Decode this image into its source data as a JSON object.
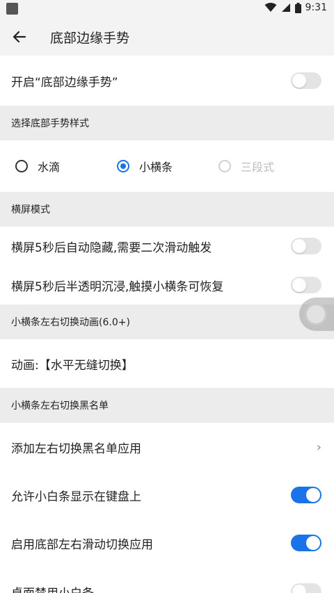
{
  "status_bar": {
    "time": "9:31",
    "left_icon": "app-square-icon",
    "icons": [
      "wifi-icon",
      "signal-icon",
      "battery-icon"
    ]
  },
  "toolbar": {
    "back_icon": "arrow-back-icon",
    "title": "底部边缘手势"
  },
  "enable_row": {
    "label": "开启“底部边缘手势”",
    "enabled": false
  },
  "style_section": {
    "title": "选择底部手势样式"
  },
  "style_options": [
    {
      "label": "水滴",
      "checked": false,
      "disabled": false
    },
    {
      "label": "小横条",
      "checked": true,
      "disabled": false
    },
    {
      "label": "三段式",
      "checked": false,
      "disabled": true
    }
  ],
  "landscape_section": {
    "title": "横屏模式"
  },
  "landscape_rows": [
    {
      "label": "横屏5秒后自动隐藏,需要二次滑动触发",
      "enabled": false
    },
    {
      "label": "横屏5秒后半透明沉浸,触摸小横条可恢复",
      "enabled": false
    }
  ],
  "anim_section": {
    "title": "小横条左右切换动画(6.0+)"
  },
  "anim_row": {
    "label": "动画:【水平无缝切换】"
  },
  "blacklist_section": {
    "title": "小横条左右切换黑名单"
  },
  "blacklist_row": {
    "label": "添加左右切换黑名单应用",
    "chevron": "›"
  },
  "bottom_rows": [
    {
      "label": "允许小白条显示在键盘上",
      "enabled": true
    },
    {
      "label": "启用底部左右滑动切换应用",
      "enabled": true
    },
    {
      "label": "桌面禁用小白条",
      "enabled": false
    }
  ],
  "colors": {
    "accent": "#1a73e8",
    "section_bg": "#ececec",
    "row_bg": "#ffffff"
  }
}
